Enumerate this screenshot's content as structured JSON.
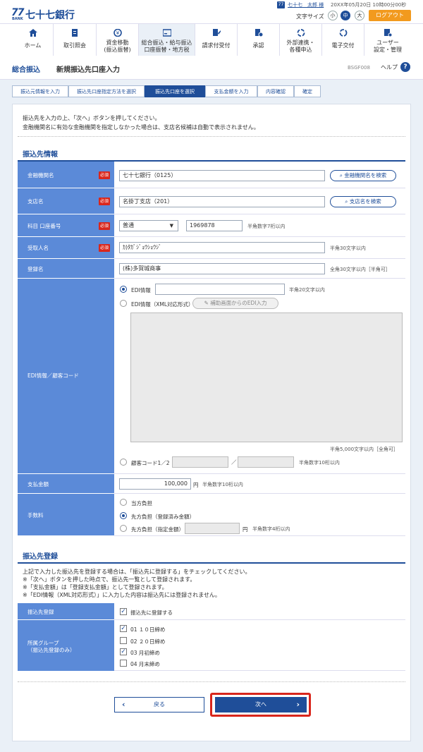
{
  "header": {
    "logo_mark": "77",
    "logo_sub": "BANK",
    "bank_name": "七十七銀行",
    "user_badge": "77",
    "user_name": "七十七　太郎 様",
    "login_time": "20XX年05月20日 10時00分00秒",
    "font_size_label": "文字サイズ",
    "font_sizes": [
      "小",
      "中",
      "大"
    ],
    "font_size_selected": "中",
    "logout_label": "ログアウト"
  },
  "nav": [
    {
      "label": "ホーム",
      "icon": "home-icon"
    },
    {
      "label": "取引照会",
      "icon": "document-icon"
    },
    {
      "label": "資金移動\n(振込振替)",
      "icon": "money-icon"
    },
    {
      "label": "総合振込・給与振込\n口座振替・地方税",
      "icon": "card-icon",
      "active": true
    },
    {
      "label": "請求付受付",
      "icon": "edit-icon"
    },
    {
      "label": "承認",
      "icon": "approve-icon"
    },
    {
      "label": "外部連携・\n各種申込",
      "icon": "link-icon"
    },
    {
      "label": "電子交付",
      "icon": "refresh-icon"
    },
    {
      "label": "ユーザー\n設定・管理",
      "icon": "user-settings-icon"
    }
  ],
  "title": {
    "main": "総合振込",
    "sub": "新規振込先口座入力",
    "code": "BSGF008",
    "help": "ヘルプ"
  },
  "steps": [
    "振込元情報を入力",
    "振込先口座指定方法を選択",
    "振込先口座を選択",
    "支払金額を入力",
    "内容確認",
    "確定"
  ],
  "active_step": 2,
  "intro": [
    "振込先を入力の上、「次へ」ボタンを押してください。",
    "金融機関名に有効な金融機関を指定しなかった場合は、支店名候補は自動で表示されません。"
  ],
  "section1": {
    "title": "振込先情報",
    "required_label": "必須",
    "bank_label": "金融機関名",
    "bank_value": "七十七銀行（0125）",
    "bank_search": "金融機関名を検索",
    "branch_label": "支店名",
    "branch_value": "名掛丁支店（201）",
    "branch_search": "支店名を検索",
    "account_label": "科目 口座番号",
    "account_type": "普通",
    "account_number": "1969878",
    "account_hint": "半角数字7桁以内",
    "payee_label": "受取人名",
    "payee_value": "ｶ)ﾀｶﾞｼﾞｮｳｼｮｳｼﾞ",
    "payee_hint": "半角30文字以内",
    "reg_label": "登録名",
    "reg_value": "(株)多賀城商事",
    "reg_hint": "全角30文字以内［半角可］",
    "edi_label": "EDI情報／顧客コード",
    "edi_opt1": "EDI情報",
    "edi_opt1_hint": "半角20文字以内",
    "edi_opt2": "EDI情報（XML対応形式）",
    "edi_helper_btn": "補助画面からのEDI入力",
    "edi_textarea_hint": "半角5,000文字以内［全角可］",
    "edi_opt3": "顧客コード1／2",
    "edi_opt3_sep": "／",
    "edi_opt3_hint": "半角数字10桁以内",
    "amount_label": "支払金額",
    "amount_value": "100,000",
    "amount_unit": "円",
    "amount_hint": "半角数字10桁以内",
    "fee_label": "手数料",
    "fee_opt1": "当方負担",
    "fee_opt2": "先方負担（登録済み金額）",
    "fee_opt3": "先方負担（指定金額）",
    "fee_unit": "円",
    "fee_hint": "半角数字4桁以内"
  },
  "section2": {
    "title": "振込先登録",
    "notes": [
      "上記で入力した振込先を登録する場合は、「振込先に登録する」をチェックしてください。",
      "※「次へ」ボタンを押した時点で、振込先一覧として登録されます。",
      "※「支払金額」は「登録支払金額」として登録されます。",
      "※「EDI情報（XML対応形式）」に入力した内容は振込先には登録されません。"
    ],
    "reg_label": "振込先登録",
    "reg_check": "振込先に登録する",
    "group_label": "所属グループ",
    "group_label2": "（振込先登録のみ）",
    "groups": [
      {
        "label": "01 １０日締め",
        "checked": true
      },
      {
        "label": "02 ２０日締め",
        "checked": false
      },
      {
        "label": "03 月初締め",
        "checked": true
      },
      {
        "label": "04 月末締め",
        "checked": false
      }
    ]
  },
  "buttons": {
    "back": "戻る",
    "next": "次へ"
  }
}
